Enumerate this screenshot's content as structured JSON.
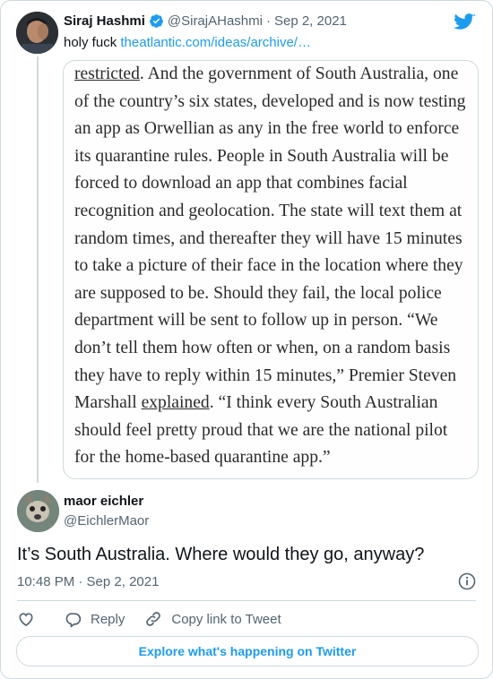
{
  "parent_tweet": {
    "name": "Siraj Hashmi",
    "handle": "@SirajAHashmi",
    "separator": "·",
    "date": "Sep 2, 2021",
    "text": "holy fuck",
    "link": "theatlantic.com/ideas/archive/…",
    "quote_lines": [
      {
        "before": "",
        "u": "restricted",
        "after": ". And the government of South Australia, one"
      },
      {
        "before": "of the country’s six states, developed and is now testing",
        "u": "",
        "after": ""
      },
      {
        "before": "an app as Orwellian as any in the free world to enforce",
        "u": "",
        "after": ""
      },
      {
        "before": "its quarantine rules. People in South Australia will be",
        "u": "",
        "after": ""
      },
      {
        "before": "forced to download an app that combines facial",
        "u": "",
        "after": ""
      },
      {
        "before": "recognition and geolocation. The state will text them at",
        "u": "",
        "after": ""
      },
      {
        "before": "random times, and thereafter they will have 15 minutes",
        "u": "",
        "after": ""
      },
      {
        "before": "to take a picture of their face in the location where they",
        "u": "",
        "after": ""
      },
      {
        "before": "are supposed to be. Should they fail, the local police",
        "u": "",
        "after": ""
      },
      {
        "before": "department will be sent to follow up in person. “We",
        "u": "",
        "after": ""
      },
      {
        "before": "don’t tell them how often or when, on a random basis",
        "u": "",
        "after": ""
      },
      {
        "before": "they have to reply within 15 minutes,” Premier Steven",
        "u": "",
        "after": ""
      },
      {
        "before": "Marshall ",
        "u": "explained",
        "after": ". “I think every South Australian"
      },
      {
        "before": "should feel pretty proud that we are the national pilot",
        "u": "",
        "after": ""
      },
      {
        "before": "for the home-based quarantine app.”",
        "u": "",
        "after": ""
      }
    ]
  },
  "reply_tweet": {
    "name": "maor eichler",
    "handle": "@EichlerMaor",
    "text": "It’s South Australia. Where would they go, anyway?",
    "meta": "10:48 PM · Sep 2, 2021"
  },
  "actions": {
    "reply": "Reply",
    "copy_link": "Copy link to Tweet"
  },
  "explore": "Explore what's happening on Twitter",
  "colors": {
    "accent": "#1d9bf0",
    "muted": "#536471",
    "border": "#cfd9de"
  }
}
